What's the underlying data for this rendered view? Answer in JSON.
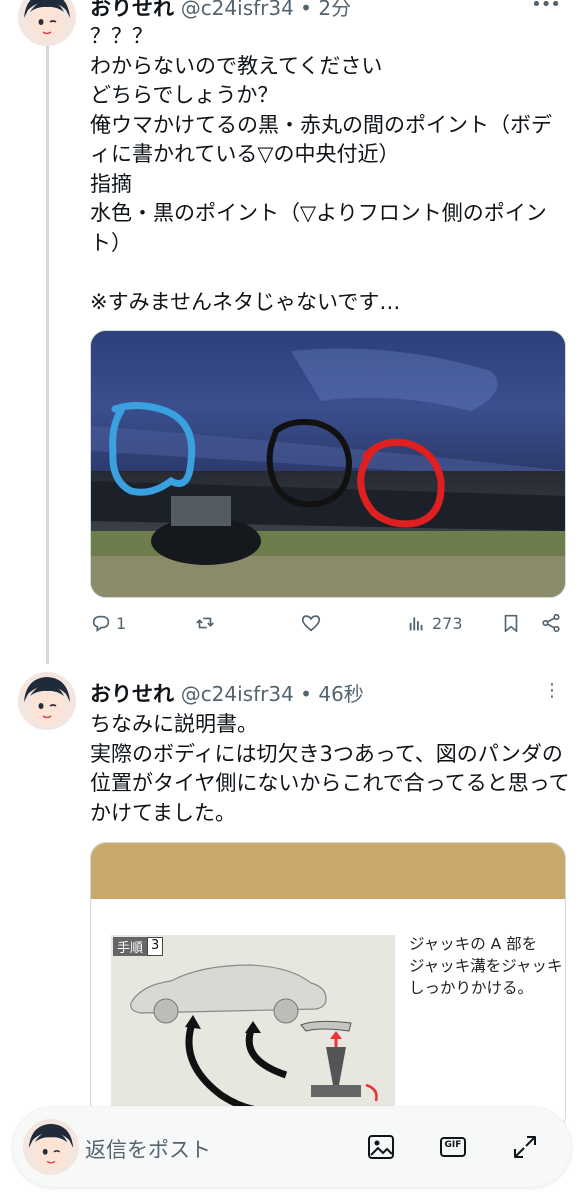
{
  "tweet1": {
    "name": "おりせれ",
    "handle": "@c24isfr34",
    "time": "2分",
    "text": "？？？\nわからないので教えてください\nどちらでしょうか？\n俺ウマかけてるの黒・赤丸の間のポイント（ボディに書かれている▽の中央付近）\n指摘\n水色・黒のポイント（▽よりフロント側のポイント）\n\n※すみませんネタじゃないです…",
    "media_icon": "car-photo-with-circles",
    "replies": "1",
    "retweets": "",
    "likes": "",
    "views": "273"
  },
  "tweet2": {
    "name": "おりせれ",
    "handle": "@c24isfr34",
    "time": "46秒",
    "text": "ちなみに説明書。\n実際のボディには切欠き3つあって、図のパンダの位置がタイヤ側にないからこれで合ってると思ってかけてました。",
    "manual": {
      "step_label": "手順",
      "step_number": "3",
      "instruction_line1": "ジャッキの A 部を",
      "instruction_line2": "ジャッキ溝をジャッキ",
      "instruction_line3": "しっかりかける。"
    }
  },
  "reply_bar": {
    "placeholder": "返信をポスト",
    "gif_label": "GIF"
  },
  "colors": {
    "text": "#0f1419",
    "muted": "#536471",
    "thread_line": "#cfd9de",
    "manual_header": "#c9a86b",
    "circle_blue": "#3aa0e0",
    "circle_black": "#111111",
    "circle_red": "#e02020"
  }
}
